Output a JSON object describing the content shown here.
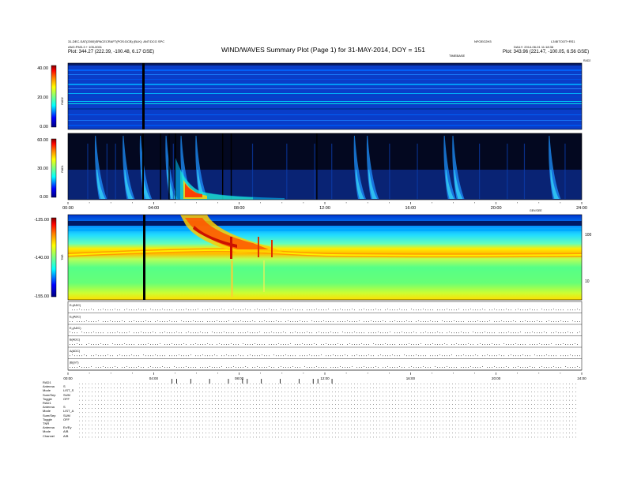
{
  "header": {
    "title": "WIND/WAVES Summary Plot (Page 1) for 31-MAY-2014, DOY = 151",
    "left_line1": "31-DEC-SAT(2000)SPACECRAFT(POS:DCB) (BLK): ANT:DCG SPC",
    "left_line2": "ANG:PM3-3 + 105-0001",
    "left_line3": "Plot:   344.27 (222.39, -100.48, 6.17 GSE)",
    "right_top_mid": "NFOEO2H3",
    "right_top_far": "L3:BITOOT+RS1",
    "right_line2": "DAILY: 2014-06-01 11:18:36",
    "right_line3": "Plot:   343.96 (221.47, -100.05, 6.56 GSE)",
    "timebase_label": "TIMEBASE",
    "rad2_corner": "RAD2",
    "rad1_corner": "RAD1"
  },
  "panels": {
    "rad2": {
      "axis_label": "RAD2",
      "colorbar_ticks": [
        "40.00",
        "20.00",
        "0.00"
      ]
    },
    "rad1": {
      "axis_label": "RAD1",
      "colorbar_ticks": [
        "60.00",
        "30.00",
        "0.00"
      ]
    },
    "tnr": {
      "axis_label": "TNR",
      "colorbar_ticks": [
        "-125.00",
        "-140.00",
        "-155.00"
      ],
      "right_ticks": [
        "100",
        "10"
      ],
      "corner_label": "GEV/GEE"
    },
    "status_labels": [
      "Eₓ(ADC)",
      "Eᵧ(ADC)",
      "E₂(ADC)",
      "B(ADC)",
      "Δ(ADC)",
      "|B|(nT)"
    ]
  },
  "time_axis": {
    "ticks": [
      "00:00",
      "04:00",
      "08:00",
      "12:00",
      "16:00",
      "20:00",
      "24:00"
    ]
  },
  "footer": {
    "rows": [
      {
        "label": "RAD1",
        "value": ""
      },
      {
        "label": "Antenna",
        "value": "S"
      },
      {
        "label": "Mode",
        "value": "LIST_S"
      },
      {
        "label": "Sum/Sep",
        "value": "SUM"
      },
      {
        "label": "Toggle",
        "value": "OFF"
      },
      {
        "label": "RAD1",
        "value": ""
      },
      {
        "label": "Antenna",
        "value": "S"
      },
      {
        "label": "Mode",
        "value": "LIST_A"
      },
      {
        "label": "Sum/Sep",
        "value": "SUM"
      },
      {
        "label": "Toggle",
        "value": "OFF"
      },
      {
        "label": "TNR",
        "value": ""
      },
      {
        "label": "Antenna",
        "value": "Ex/Ey"
      },
      {
        "label": "Mode",
        "value": "A/B"
      },
      {
        "label": "Channel",
        "value": "A/B"
      }
    ]
  },
  "colors": {
    "colormap": [
      "#00007f",
      "#0000ff",
      "#007fff",
      "#00ffff",
      "#7fff7f",
      "#ffff00",
      "#ff7f00",
      "#ff0000",
      "#7f0000"
    ]
  },
  "chart_data": [
    {
      "type": "heatmap",
      "panel": "RAD2",
      "x_range_hours": [
        0,
        24
      ],
      "colorbar_range": [
        0,
        40
      ],
      "description_features": [
        "persistent horizontal interference lines",
        "data gap near 03:45"
      ]
    },
    {
      "type": "heatmap",
      "panel": "RAD1",
      "x_range_hours": [
        0,
        24
      ],
      "colorbar_range": [
        0,
        60
      ],
      "bursts_hours": [
        1.3,
        2.6,
        3.4,
        4.6,
        5.3,
        6.0,
        13.4,
        14.0,
        17.6,
        18.0,
        22.5
      ],
      "strong_event_hours": [
        5.3,
        7.5
      ]
    },
    {
      "type": "heatmap",
      "panel": "TNR",
      "x_range_hours": [
        0,
        24
      ],
      "colorbar_range": [
        -155,
        -125
      ],
      "right_axis_ticks": [
        100,
        10
      ]
    }
  ]
}
